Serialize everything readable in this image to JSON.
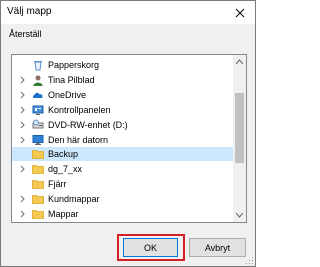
{
  "window": {
    "title": "Välj mapp",
    "close_icon": "close-icon"
  },
  "instruction": "Återställ",
  "tree": {
    "items": [
      {
        "label": "Papperskorg",
        "icon": "recycle-bin-icon",
        "expandable": false,
        "selected": false
      },
      {
        "label": "Tina Pilblad",
        "icon": "user-icon",
        "expandable": true,
        "selected": false
      },
      {
        "label": "OneDrive",
        "icon": "cloud-icon",
        "expandable": true,
        "selected": false
      },
      {
        "label": "Kontrollpanelen",
        "icon": "control-panel-icon",
        "expandable": true,
        "selected": false
      },
      {
        "label": "DVD-RW-enhet (D:)",
        "icon": "dvd-drive-icon",
        "expandable": true,
        "selected": false
      },
      {
        "label": "Den här datorn",
        "icon": "computer-icon",
        "expandable": true,
        "selected": false
      },
      {
        "label": "Backup",
        "icon": "folder-icon",
        "expandable": false,
        "selected": true
      },
      {
        "label": "dg_7_xx",
        "icon": "folder-icon",
        "expandable": true,
        "selected": false
      },
      {
        "label": "Fjärr",
        "icon": "folder-icon",
        "expandable": false,
        "selected": false
      },
      {
        "label": "Kundmappar",
        "icon": "folder-icon",
        "expandable": true,
        "selected": false
      },
      {
        "label": "Mappar",
        "icon": "folder-icon",
        "expandable": true,
        "selected": false
      }
    ]
  },
  "buttons": {
    "ok_label": "OK",
    "cancel_label": "Avbryt"
  },
  "colors": {
    "highlight": "#d62027",
    "selection": "#cce8ff",
    "focus_border": "#0078d7",
    "folder": "#f4c94f"
  }
}
